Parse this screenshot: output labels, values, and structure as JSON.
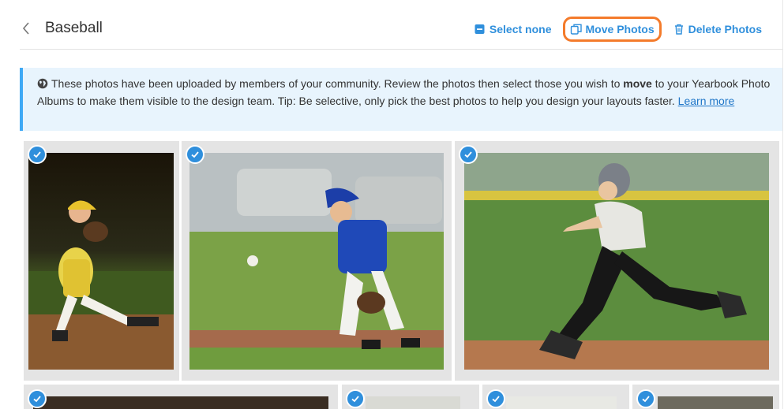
{
  "header": {
    "title": "Baseball",
    "select_none_label": "Select none",
    "move_photos_label": "Move Photos",
    "delete_photos_label": "Delete Photos"
  },
  "notice": {
    "text_before_bold": "These photos have been uploaded by members of your community. Review the photos then select those you wish to ",
    "bold_word": "move",
    "text_after_bold": " to your Yearbook Photo Albums to make them visible to the design team. Tip: Be selective, only pick the best photos to help you design your layouts faster.",
    "link_text": "Learn more"
  },
  "colors": {
    "accent": "#2f8fdc",
    "highlight_outline": "#f47b2b",
    "notice_background": "#e8f4fd",
    "notice_border": "#3fa9f5"
  },
  "photos": [
    {
      "description": "child pitcher in yellow and red uniform",
      "selected": true
    },
    {
      "description": "child fielder in blue jersey watching ball",
      "selected": true
    },
    {
      "description": "child runner in grey jersey and black pants",
      "selected": true
    },
    {
      "description": "photo (partially visible)",
      "selected": true
    },
    {
      "description": "photo (partially visible)",
      "selected": true
    },
    {
      "description": "photo (partially visible)",
      "selected": true
    },
    {
      "description": "photo (partially visible)",
      "selected": true
    }
  ]
}
